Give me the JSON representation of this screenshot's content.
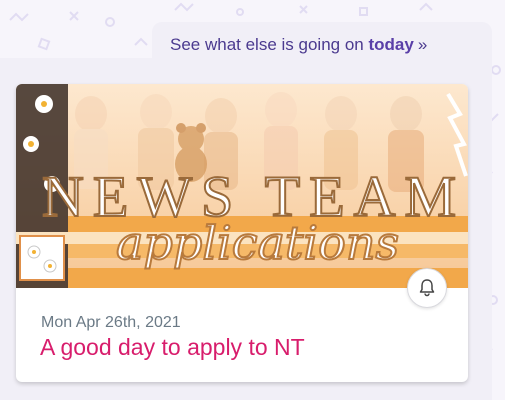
{
  "see_more": {
    "prefix": "See what else is going on",
    "emphasis": "today",
    "chevron": "»"
  },
  "card": {
    "banner": {
      "headline": "NEWS TEAM",
      "script_text": "applications"
    },
    "date": "Mon Apr 26th, 2021",
    "title": "A good day to apply to NT"
  },
  "icons": {
    "bell": "bell-icon"
  },
  "colors": {
    "link": "#4b3a8f",
    "title": "#d81d6c",
    "date": "#6b7a86",
    "banner_orange": "#f2a84a",
    "banner_cream": "#fbe3c0"
  }
}
